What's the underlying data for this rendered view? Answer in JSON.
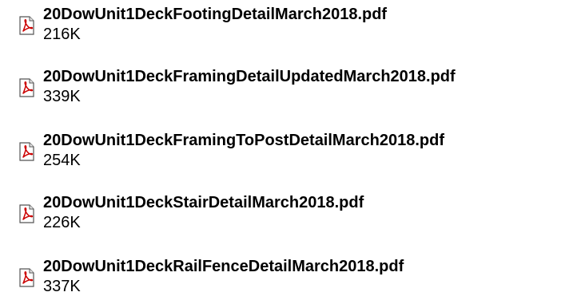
{
  "files": [
    {
      "name": "20DowUnit1DeckFootingDetailMarch2018.pdf",
      "size": "216K",
      "icon": "pdf-file-icon"
    },
    {
      "name": "20DowUnit1DeckFramingDetailUpdatedMarch2018.pdf",
      "size": "339K",
      "icon": "pdf-file-icon"
    },
    {
      "name": "20DowUnit1DeckFramingToPostDetailMarch2018.pdf",
      "size": "254K",
      "icon": "pdf-file-icon"
    },
    {
      "name": "20DowUnit1DeckStairDetailMarch2018.pdf",
      "size": "226K",
      "icon": "pdf-file-icon"
    },
    {
      "name": "20DowUnit1DeckRailFenceDetailMarch2018.pdf",
      "size": "337K",
      "icon": "pdf-file-icon"
    }
  ],
  "colors": {
    "text": "#000000",
    "pdf_red": "#cc0000",
    "background": "#ffffff"
  }
}
